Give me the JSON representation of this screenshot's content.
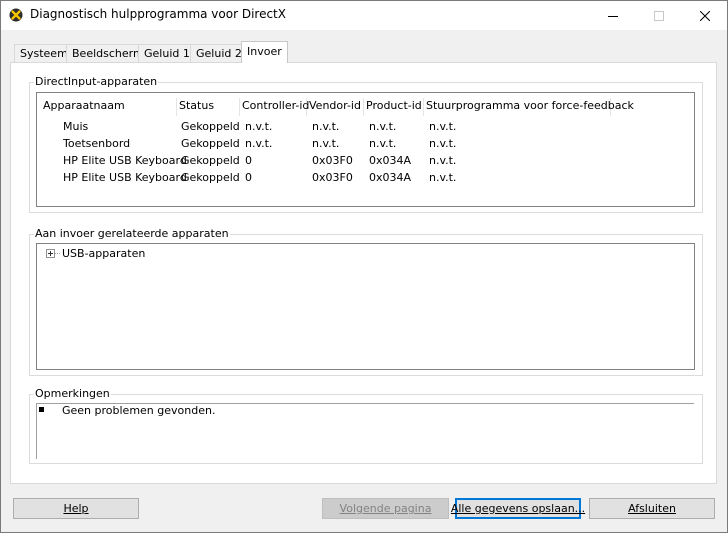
{
  "window": {
    "title": "Diagnostisch hulpprogramma voor DirectX",
    "icon": "directx-icon"
  },
  "tabs": [
    {
      "label": "Systeem"
    },
    {
      "label": "Beeldscherm"
    },
    {
      "label": "Geluid 1"
    },
    {
      "label": "Geluid 2"
    },
    {
      "label": "Invoer",
      "active": true
    }
  ],
  "directinput": {
    "label": "DirectInput-apparaten",
    "columns": [
      "Apparaatnaam",
      "Status",
      "Controller-id",
      "Vendor-id",
      "Product-id",
      "Stuurprogramma voor force-feedback"
    ],
    "rows": [
      [
        "Muis",
        "Gekoppeld",
        "n.v.t.",
        "n.v.t.",
        "n.v.t.",
        "n.v.t."
      ],
      [
        "Toetsenbord",
        "Gekoppeld",
        "n.v.t.",
        "n.v.t.",
        "n.v.t.",
        "n.v.t."
      ],
      [
        "HP Elite USB Keyboard",
        "Gekoppeld",
        "0",
        "0x03F0",
        "0x034A",
        "n.v.t."
      ],
      [
        "HP Elite USB Keyboard",
        "Gekoppeld",
        "0",
        "0x03F0",
        "0x034A",
        "n.v.t."
      ]
    ]
  },
  "related": {
    "label": "Aan invoer gerelateerde apparaten",
    "tree": [
      {
        "label": "USB-apparaten",
        "expand_icon": "plus-box-icon"
      }
    ]
  },
  "notes": {
    "label": "Opmerkingen",
    "items": [
      "Geen problemen gevonden."
    ]
  },
  "buttons": {
    "help": "Help",
    "next_page": "Volgende pagina",
    "save_all": "Alle gegevens opslaan...",
    "close": "Afsluiten"
  }
}
